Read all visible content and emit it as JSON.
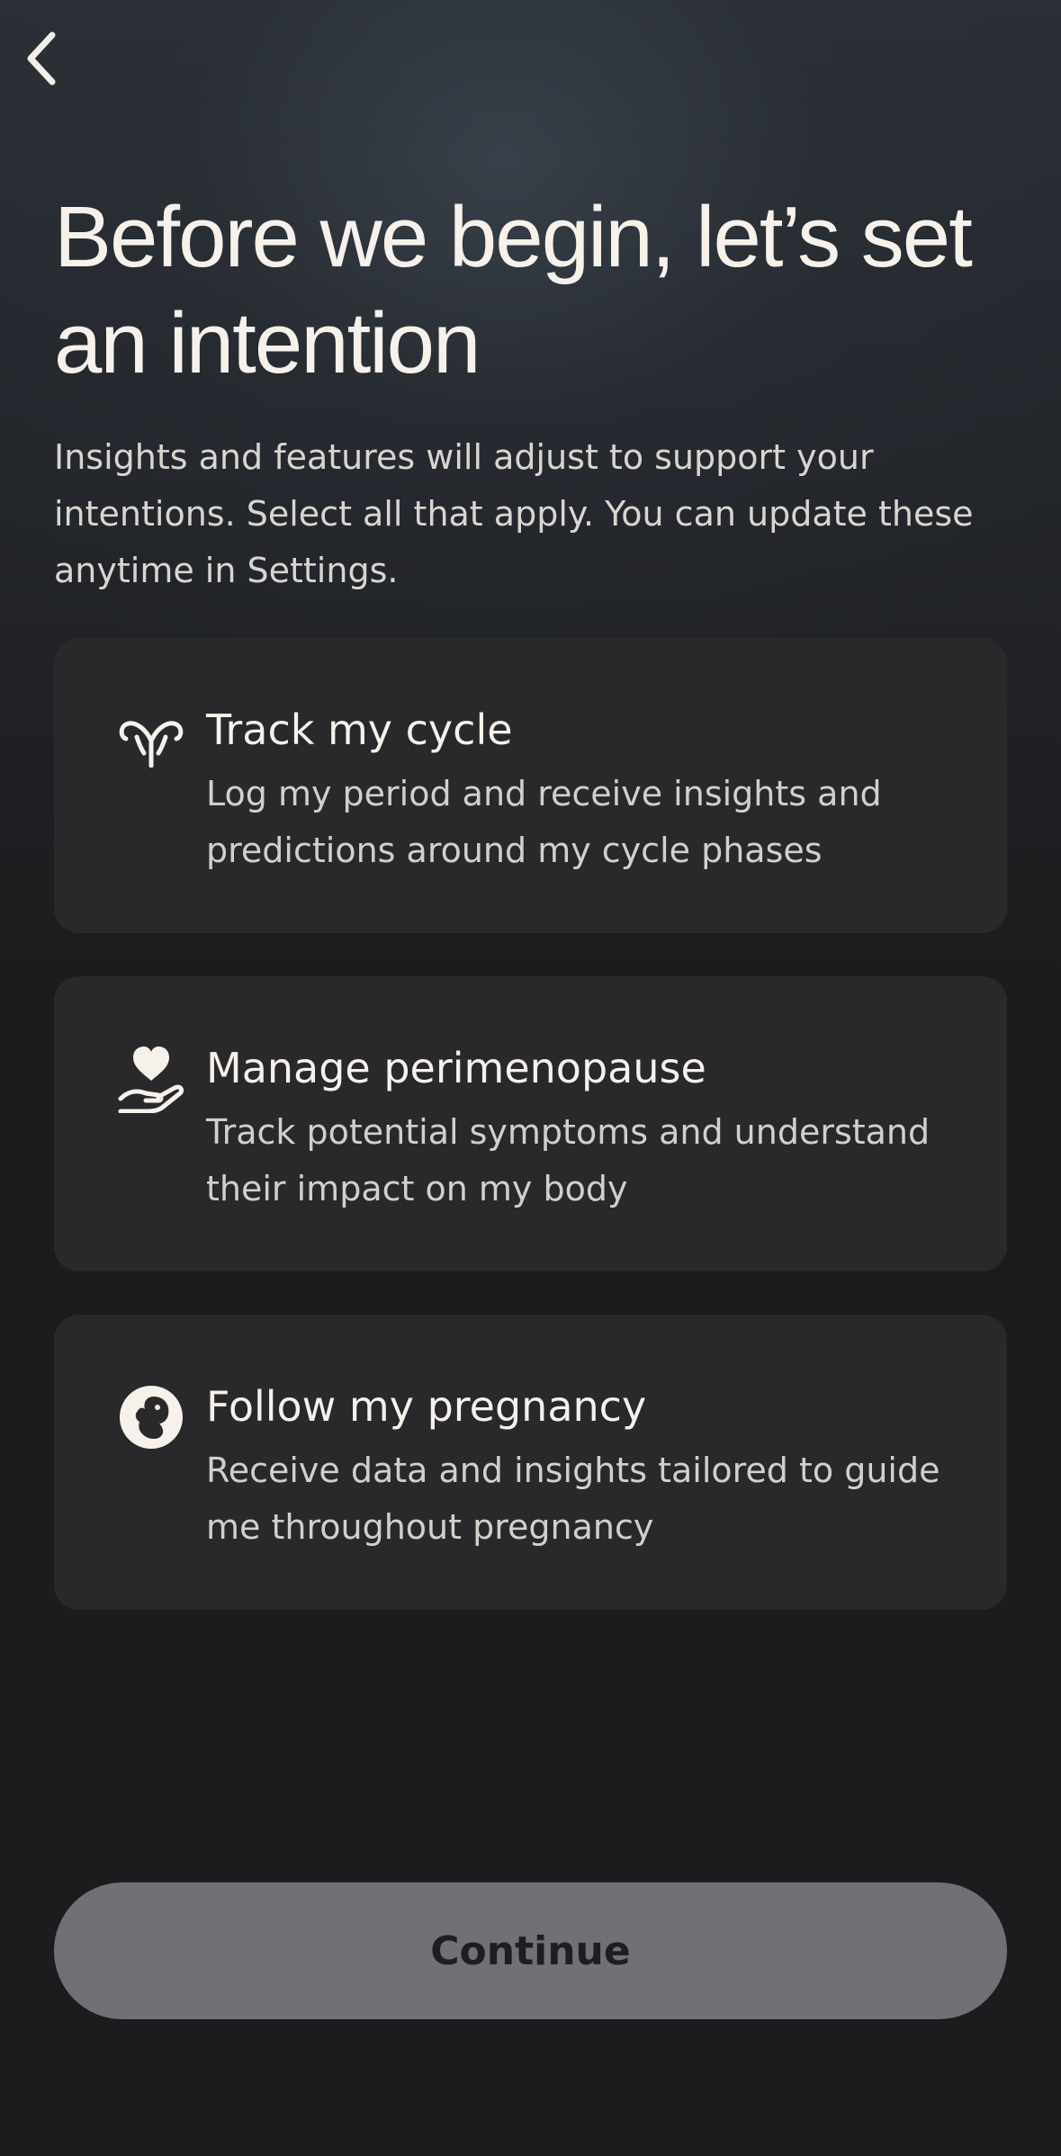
{
  "header": {
    "back_icon": "chevron-left-icon",
    "title": "Before we begin, let’s set an intention",
    "subtitle": "Insights and features will adjust to support your intentions. Select all that apply. You can update these anytime in Settings."
  },
  "options": [
    {
      "icon": "uterus-icon",
      "title": "Track my cycle",
      "description": "Log my period and receive insights and predictions around my cycle phases"
    },
    {
      "icon": "heart-in-hand-icon",
      "title": "Manage perimenopause",
      "description": "Track potential symptoms and understand their impact on my body"
    },
    {
      "icon": "fetus-icon",
      "title": "Follow my pregnancy",
      "description": "Receive data and insights tailored to guide me throughout pregnancy"
    }
  ],
  "footer": {
    "continue_label": "Continue"
  },
  "colors": {
    "background": "#1c1c1e",
    "card": "#29292c",
    "text": "#f6f1ea",
    "button_disabled": "#6f7174"
  }
}
